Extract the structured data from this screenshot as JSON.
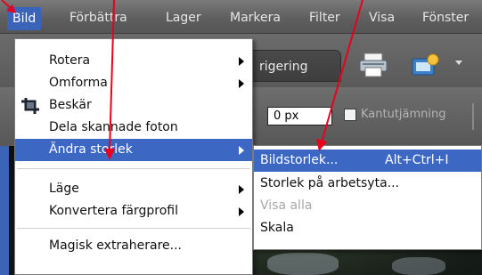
{
  "menubar": {
    "items": [
      "Bild",
      "Förbättra",
      "Lager",
      "Markera",
      "Filter",
      "Visa",
      "Fönster"
    ]
  },
  "background": {
    "tab_label": "rigering",
    "feather_value": "0 px",
    "antialias_label": "Kantutjämning",
    "icons": [
      "printer-icon",
      "share-icon"
    ]
  },
  "menu": {
    "items": [
      {
        "label": "Rotera",
        "submenu": true
      },
      {
        "label": "Omforma",
        "submenu": true
      },
      {
        "label": "Beskär",
        "icon": "crop-icon"
      },
      {
        "label": "Dela skannade foton"
      },
      {
        "label": "Ändra storlek",
        "submenu": true,
        "highlighted": true
      },
      {
        "label": "Läge",
        "submenu": true
      },
      {
        "label": "Konvertera färgprofil",
        "submenu": true
      },
      {
        "label": "Magisk extraherare..."
      }
    ]
  },
  "submenu": {
    "items": [
      {
        "label": "Bildstorlek...",
        "shortcut": "Alt+Ctrl+I",
        "highlighted": true
      },
      {
        "label": "Storlek på arbetsyta..."
      },
      {
        "label": "Visa alla",
        "disabled": true
      },
      {
        "label": "Skala"
      }
    ]
  },
  "colors": {
    "highlight": "#3c68c4",
    "annotation_arrow": "#e8001c"
  }
}
